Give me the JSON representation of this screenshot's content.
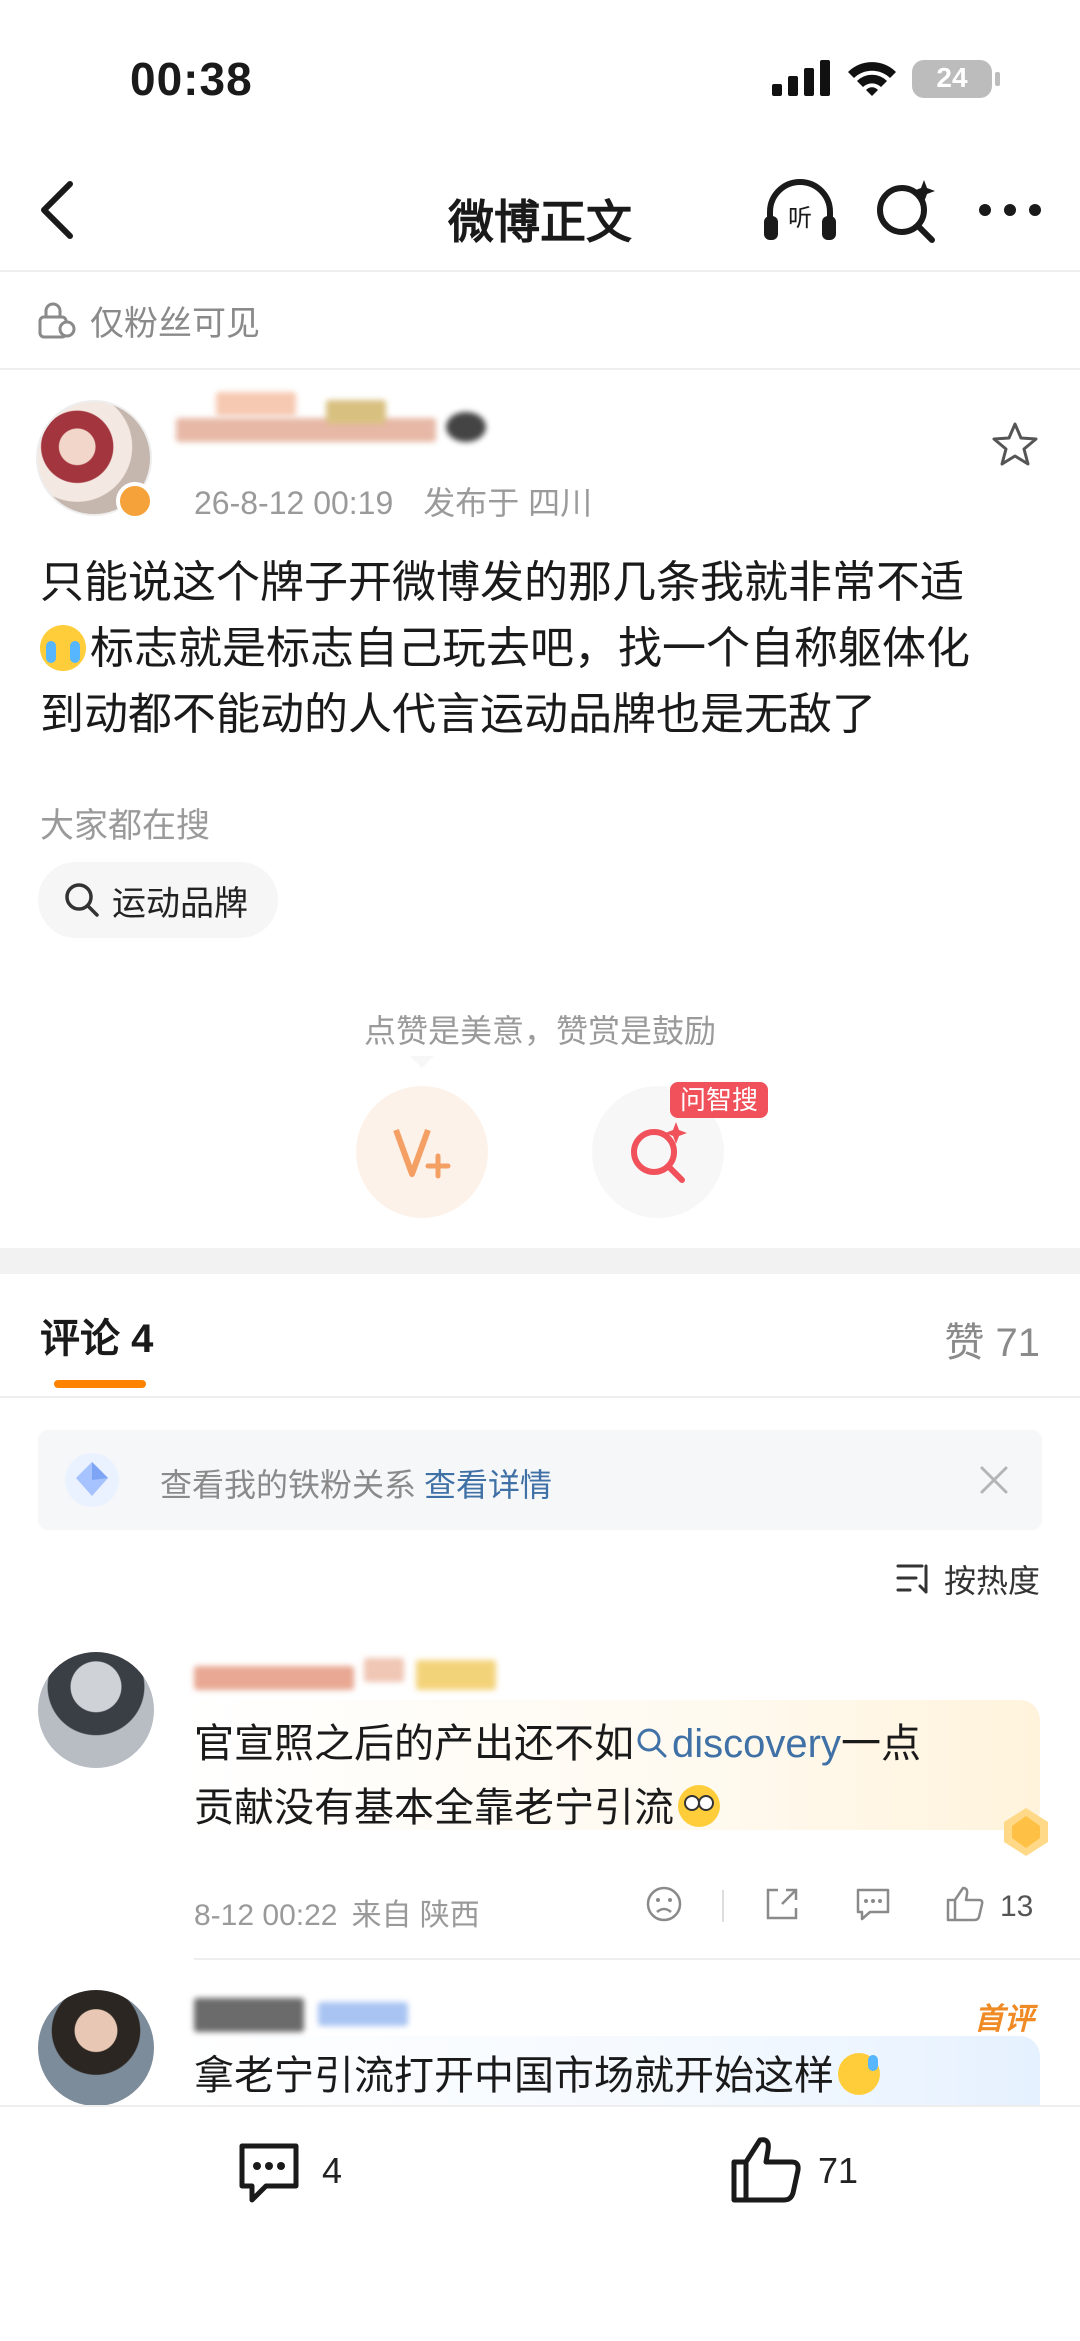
{
  "status_bar": {
    "time": "00:38",
    "battery": "24"
  },
  "nav": {
    "title": "微博正文",
    "icons": [
      "back-icon",
      "listen-icon",
      "search-icon",
      "more-icon"
    ]
  },
  "visibility": {
    "label": "仅粉丝可见"
  },
  "post": {
    "timestamp": "26-8-12 00:19",
    "location": "发布于 四川",
    "text_line1": "只能说这个牌子开微博发的那几条我就非常不适",
    "text_line2": "标志就是标志自己玩去吧，找一个自称躯体化",
    "text_line3": "到动都不能动的人代言运动品牌也是无敌了",
    "searching_label": "大家都在搜",
    "search_chip": "运动品牌",
    "reward_text": "点赞是美意，赞赏是鼓励",
    "ask_badge": "问智搜"
  },
  "comments_header": {
    "tab_label": "评论 4",
    "likes_label": "赞 71",
    "accent_color": "#ff8200"
  },
  "fan_bar": {
    "text": "查看我的铁粉关系",
    "link": "查看详情"
  },
  "sort": {
    "label": "按热度"
  },
  "comments": [
    {
      "text_line1_pre": "官宣照之后的产出还不如",
      "topic": "discovery",
      "text_line1_post": "一点",
      "text_line2": "贡献没有基本全靠老宁引流",
      "time": "8-12 00:22",
      "source": "来自 陕西",
      "like_count": "13"
    },
    {
      "badge": "首评",
      "text": "拿老宁引流打开中国市场就开始这样"
    }
  ],
  "bottom_bar": {
    "comment_count": "4",
    "like_count": "71"
  },
  "colors": {
    "link": "#3f70a6",
    "muted": "#9a9a9a",
    "accent": "#ff8200",
    "badge_red": "#f0515a"
  }
}
